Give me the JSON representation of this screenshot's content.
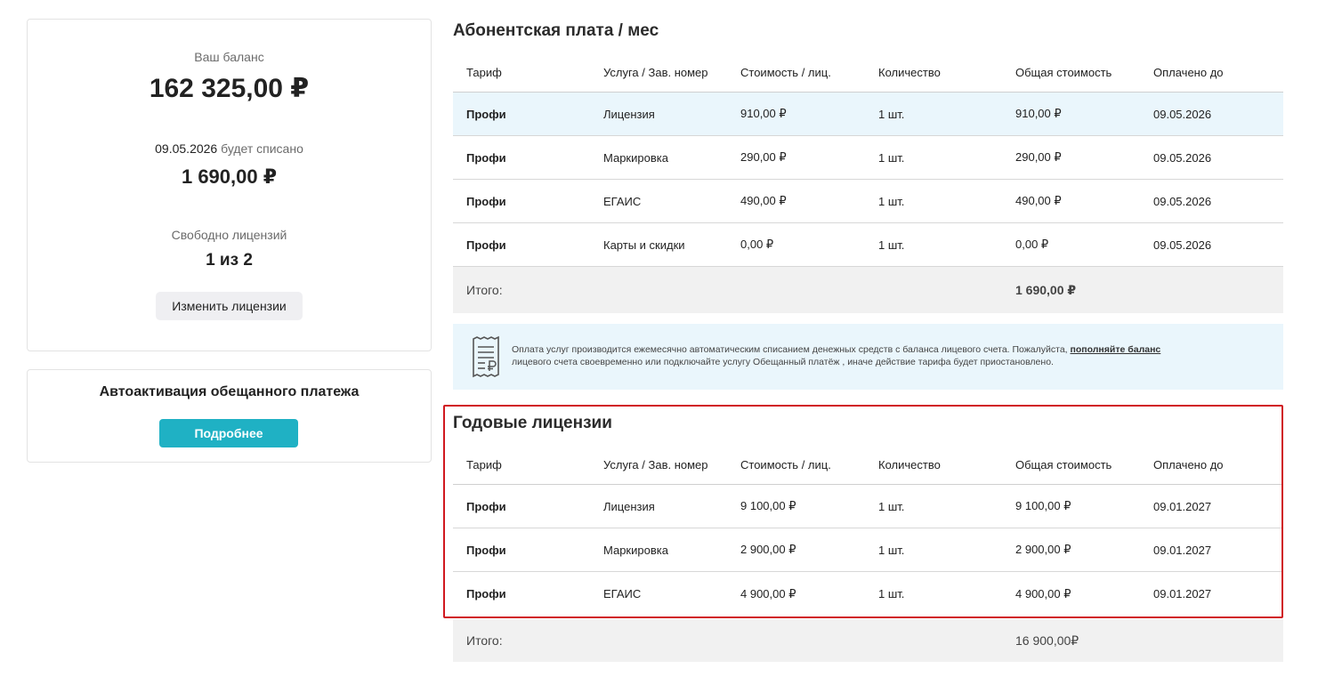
{
  "balance": {
    "label": "Ваш баланс",
    "amount": "162 325,00 ₽",
    "charge_date": "09.05.2026",
    "charge_label": "будет списано",
    "charge_amount": "1 690,00 ₽",
    "free_label": "Свободно лицензий",
    "free_value": "1 из 2",
    "change_button": "Изменить лицензии"
  },
  "promise": {
    "title": "Автоактивация обещанного платежа",
    "button": "Подробнее"
  },
  "monthly": {
    "title": "Абонентская плата / мес",
    "headers": [
      "Тариф",
      "Услуга / Зав. номер",
      "Стоимость / лиц.",
      "Количество",
      "Общая стоимость",
      "Оплачено до"
    ],
    "rows": [
      {
        "tariff": "Профи",
        "service": "Лицензия",
        "price": "910,00 ₽",
        "qty": "1 шт.",
        "total": "910,00 ₽",
        "paid_until": "09.05.2026"
      },
      {
        "tariff": "Профи",
        "service": "Маркировка",
        "price": "290,00 ₽",
        "qty": "1 шт.",
        "total": "290,00 ₽",
        "paid_until": "09.05.2026"
      },
      {
        "tariff": "Профи",
        "service": "ЕГАИС",
        "price": "490,00 ₽",
        "qty": "1 шт.",
        "total": "490,00 ₽",
        "paid_until": "09.05.2026"
      },
      {
        "tariff": "Профи",
        "service": "Карты и скидки",
        "price": "0,00 ₽",
        "qty": "1 шт.",
        "total": "0,00 ₽",
        "paid_until": "09.05.2026"
      }
    ],
    "total_label": "Итого:",
    "total_value": "1 690,00 ₽"
  },
  "info": {
    "text_before": "Оплата услуг производится ежемесячно автоматическим списанием денежных средств с баланса лицевого счета. Пожалуйста,",
    "link": "пополняйте баланс",
    "text_after": "лицевого счета своевременно или подключайте услугу Обещанный платёж , иначе действие тарифа будет приостановлено."
  },
  "annual": {
    "title": "Годовые лицензии",
    "headers": [
      "Тариф",
      "Услуга / Зав. номер",
      "Стоимость / лиц.",
      "Количество",
      "Общая стоимость",
      "Оплачено до"
    ],
    "rows": [
      {
        "tariff": "Профи",
        "service": "Лицензия",
        "price": "9 100,00 ₽",
        "qty": "1 шт.",
        "total": "9 100,00 ₽",
        "paid_until": "09.01.2027"
      },
      {
        "tariff": "Профи",
        "service": "Маркировка",
        "price": "2 900,00 ₽",
        "qty": "1 шт.",
        "total": "2 900,00 ₽",
        "paid_until": "09.01.2027"
      },
      {
        "tariff": "Профи",
        "service": "ЕГАИС",
        "price": "4 900,00 ₽",
        "qty": "1 шт.",
        "total": "4 900,00 ₽",
        "paid_until": "09.01.2027"
      }
    ],
    "total_label": "Итого:",
    "total_value": "16 900,00₽"
  },
  "colors": {
    "accent": "#1fb1c4",
    "highlight_row": "#eaf6fc",
    "frame": "#d0181f"
  }
}
